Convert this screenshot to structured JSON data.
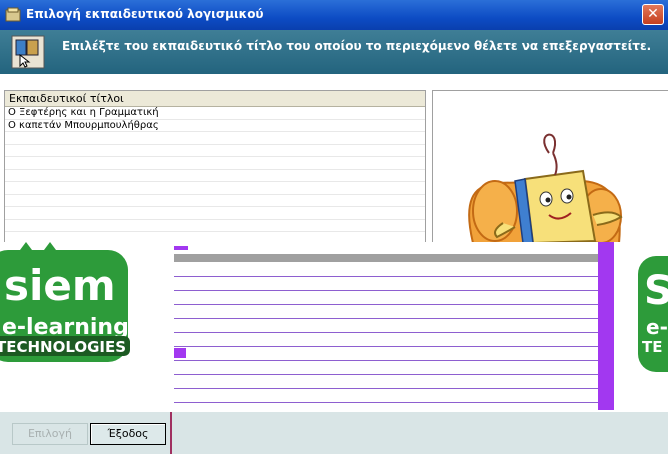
{
  "window": {
    "title": "Επιλογή εκπαιδευτικού λογισμικού",
    "close_glyph": "✕"
  },
  "header": {
    "message": "Επιλέξτε του εκπαιδευτικό τίτλο του οποίου το περιεχόμενο θέλετε να επεξεργαστείτε."
  },
  "titles_list": {
    "column_header": "Εκπαιδευτικοί τίτλοι",
    "items": [
      "Ο Ξεφτέρης και η Γραμματική",
      "Ο καπετάν Μπουρμπουλήθρας",
      "",
      "",
      "",
      "",
      "",
      "",
      "",
      ""
    ]
  },
  "logo": {
    "line1": "siem",
    "line2": "e-learning",
    "line3": "TECHNOLOGIES",
    "partial_line1": "S",
    "partial_line2": "e-",
    "partial_line3": "TE"
  },
  "buttons": {
    "select": "Επιλογή",
    "exit": "Έξοδος"
  },
  "colors": {
    "titlebar": "#0d4cc4",
    "header": "#2d6e86",
    "logo_green": "#2d9b3a",
    "scroll_purple": "#a238f0"
  }
}
